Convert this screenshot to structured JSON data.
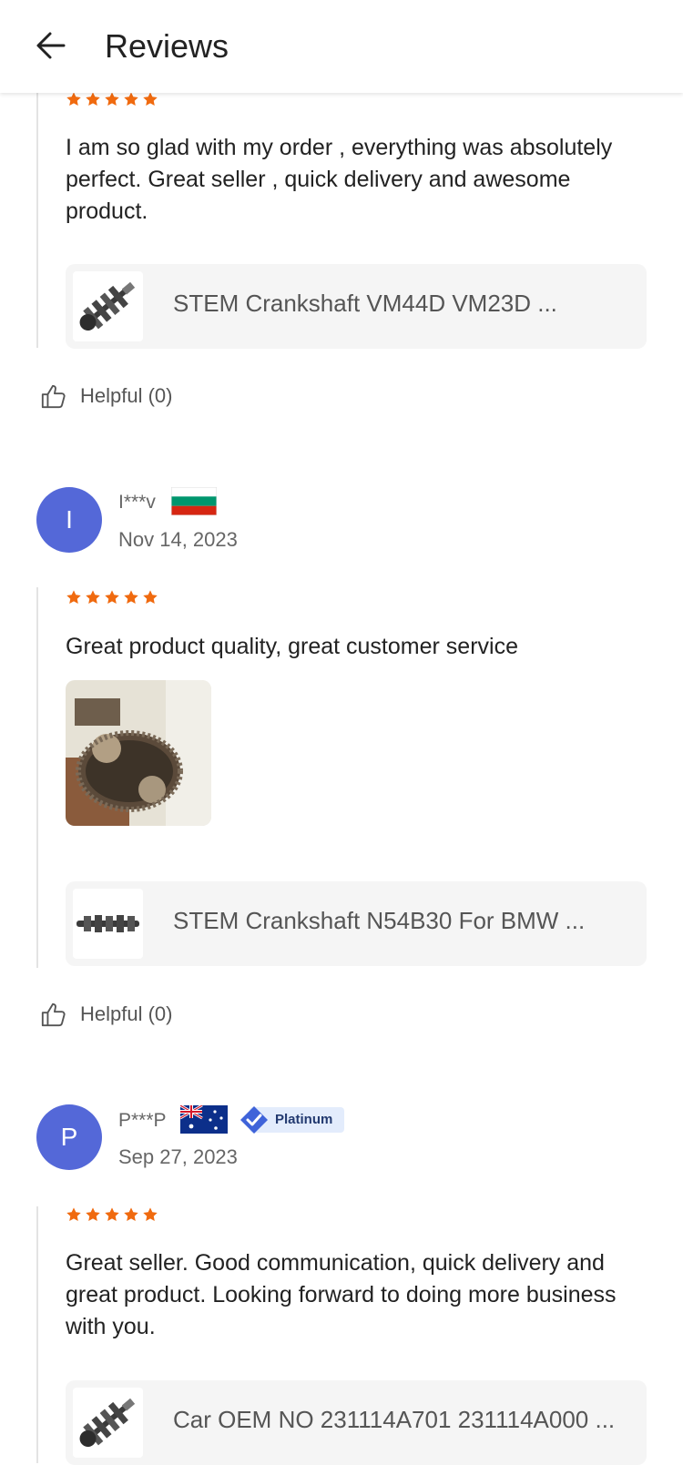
{
  "header": {
    "title": "Reviews",
    "back_icon": "arrow-left-icon"
  },
  "colors": {
    "star": "#f06a0f",
    "avatar": "#5468d8",
    "card": "#f5f5f5",
    "platinum_badge": "#3f63d9"
  },
  "reviews": [
    {
      "rating": 5,
      "text": "I am so glad with my order , everything was absolutely perfect. Great seller , quick delivery and awesome product.",
      "product": {
        "title": "STEM Crankshaft VM44D VM23D ..."
      },
      "helpful_label": "Helpful (0)"
    },
    {
      "avatar_letter": "I",
      "username": "I***v",
      "flag": "bulgaria-flag",
      "date": "Nov 14, 2023",
      "rating": 5,
      "text": "Great product quality,  great customer service",
      "photo": "crankshaft-photo",
      "product": {
        "title": "STEM Crankshaft N54B30 For  BMW  ..."
      },
      "helpful_label": "Helpful (0)"
    },
    {
      "avatar_letter": "P",
      "username": "P***P",
      "flag": "australia-flag",
      "badge": "Platinum",
      "date": "Sep 27, 2023",
      "rating": 5,
      "text": "Great seller. Good communication, quick delivery and great product. Looking forward to doing more business with you.",
      "product": {
        "title": "Car OEM NO 231114A701 231114A000 ..."
      }
    }
  ]
}
